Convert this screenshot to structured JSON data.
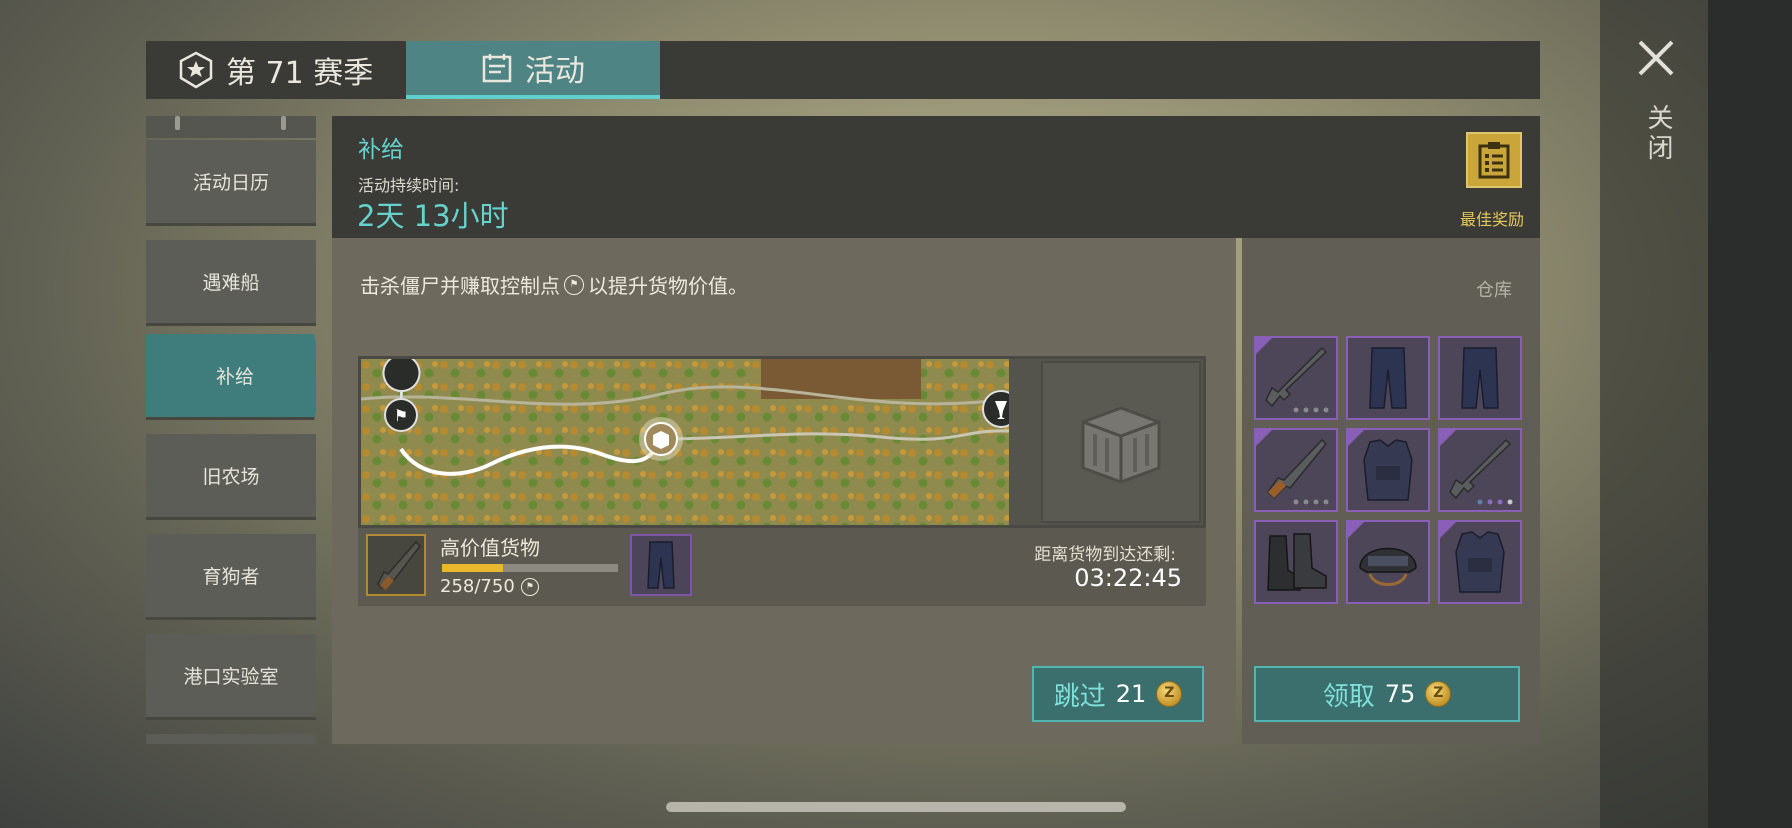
{
  "tabs": {
    "season_label": "第 71 赛季",
    "events_label": "活动"
  },
  "sidebar": {
    "items": [
      {
        "label": "活动日历"
      },
      {
        "label": "遇难船"
      },
      {
        "label": "补给",
        "active": true
      },
      {
        "label": "旧农场"
      },
      {
        "label": "育狗者"
      },
      {
        "label": "港口实验室"
      }
    ]
  },
  "header": {
    "title": "补给",
    "duration_label": "活动持续时间:",
    "duration_value": "2天 13小时",
    "best_reward_label": "最佳奖励"
  },
  "main": {
    "instruction_before": "击杀僵尸并赚取控制点",
    "instruction_after": "以提升货物价值。",
    "cargo": {
      "name": "高价值货物",
      "count": "258/750",
      "progress": 0.344
    },
    "arrival_label": "距离货物到达还剩:",
    "arrival_time": "03:22:45",
    "skip_label": "跳过",
    "skip_cost": "21"
  },
  "warehouse": {
    "title": "仓库",
    "items": [
      "assault-rifle",
      "tactical-pants",
      "tactical-pants",
      "hunting-rifle",
      "armored-vest",
      "assault-rifle",
      "combat-boots",
      "combat-helmet",
      "armored-vest"
    ],
    "claim_label": "领取",
    "claim_cost": "75"
  },
  "close_label": "关闭",
  "colors": {
    "accent": "#66d2cc",
    "button": "#3a6f6e",
    "epic": "#8a5fb8",
    "gold": "#e6c95a"
  }
}
